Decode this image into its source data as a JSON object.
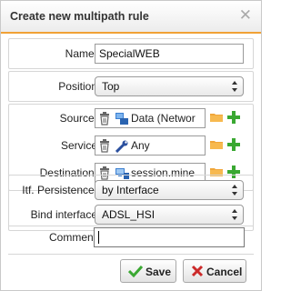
{
  "dialog": {
    "title": "Create new multipath rule",
    "close_symbol": "✕"
  },
  "form": {
    "name": {
      "label": "Name:",
      "value": "SpecialWEB"
    },
    "position": {
      "label": "Position",
      "selected": "Top"
    },
    "source": {
      "label": "Source:",
      "value": "Data (Networ",
      "icon": "network-icon"
    },
    "service": {
      "label": "Service",
      "value": "Any",
      "icon": "service-icon"
    },
    "destination": {
      "label": "Destination:",
      "value": "session.mine",
      "icon": "host-icon"
    },
    "persistence": {
      "label": "Itf. Persistence:",
      "selected": "by Interface"
    },
    "bind_interface": {
      "label": "Bind interface",
      "selected": "ADSL_HSI"
    },
    "comment": {
      "label": "Comment",
      "value": ""
    }
  },
  "buttons": {
    "save": "Save",
    "cancel": "Cancel"
  },
  "colors": {
    "accent": "#f0a136",
    "save_check": "#3aa832",
    "cancel_x": "#cc2a2a",
    "add_plus": "#3aa832",
    "folder": "#f0a63a"
  }
}
